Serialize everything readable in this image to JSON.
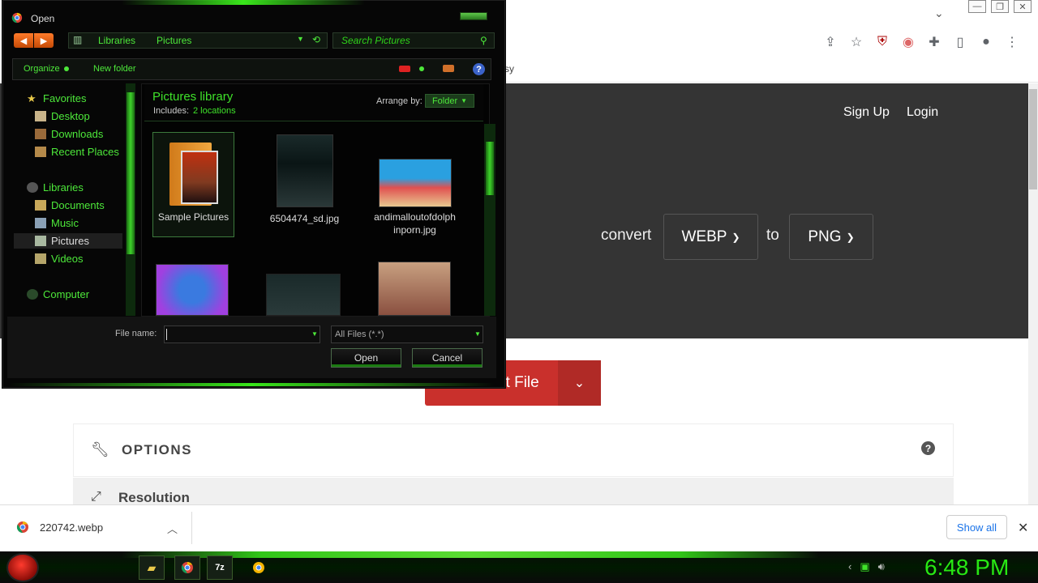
{
  "browser": {
    "bookmark_fragment": "sy"
  },
  "page": {
    "nav": {
      "signup": "Sign Up",
      "login": "Login"
    },
    "convert_label": "convert",
    "from_format": "WEBP",
    "to_label": "to",
    "to_format": "PNG",
    "select_file": "Select File",
    "options_title": "OPTIONS",
    "resolution_label": "Resolution"
  },
  "download_bar": {
    "file": "220742.webp",
    "show_all": "Show all"
  },
  "taskbar": {
    "clock": "6:48 PM"
  },
  "dialog": {
    "title": "Open",
    "breadcrumb": [
      "Libraries",
      "Pictures"
    ],
    "search_placeholder": "Search Pictures",
    "organize": "Organize",
    "new_folder": "New folder",
    "nav": {
      "favorites": "Favorites",
      "desktop": "Desktop",
      "downloads": "Downloads",
      "recent": "Recent Places",
      "libraries": "Libraries",
      "documents": "Documents",
      "music": "Music",
      "pictures": "Pictures",
      "videos": "Videos",
      "computer": "Computer"
    },
    "library_title": "Pictures library",
    "includes_label": "Includes:",
    "includes_link": "2 locations",
    "arrange_label": "Arrange by:",
    "arrange_value": "Folder",
    "items": [
      {
        "label": "Sample Pictures"
      },
      {
        "label": "6504474_sd.jpg"
      },
      {
        "label": "andimalloutofdolphinporn.jpg"
      }
    ],
    "filename_label": "File name:",
    "filename_value": "",
    "filetype": "All Files (*.*)",
    "open_button": "Open",
    "cancel_button": "Cancel"
  },
  "colors": {
    "accent_green": "#3fe22a",
    "select_file_red": "#c9302c",
    "hero_bg": "#343434"
  }
}
